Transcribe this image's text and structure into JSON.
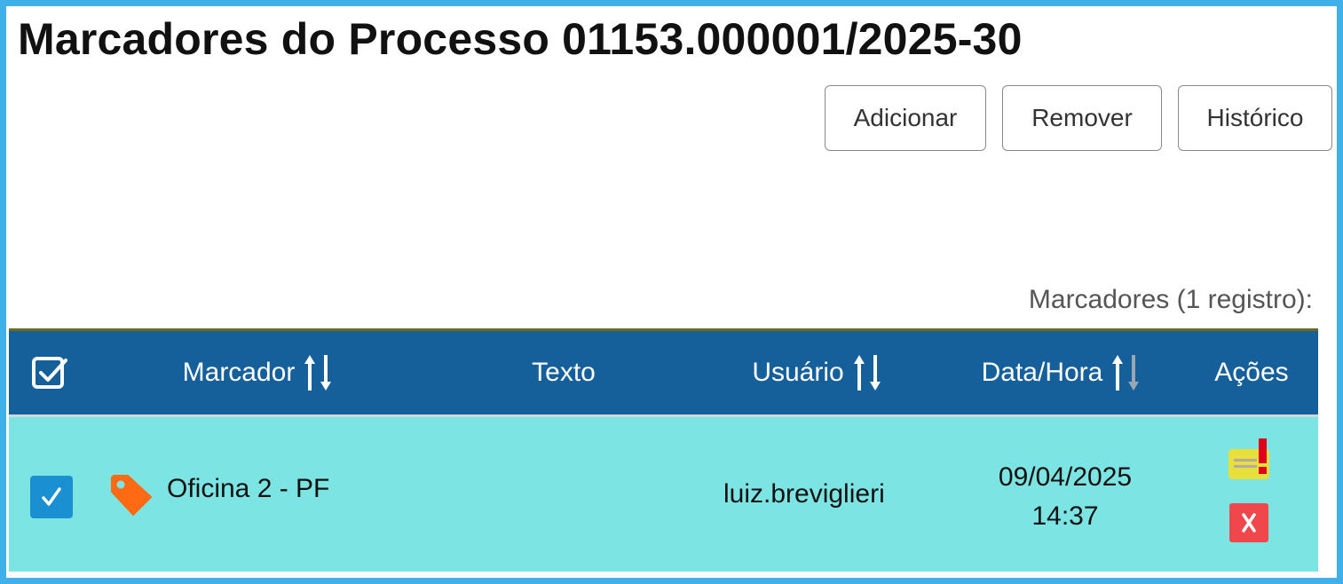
{
  "page": {
    "title": "Marcadores do Processo 01153.000001/2025-30"
  },
  "toolbar": {
    "add_label": "Adicionar",
    "remove_label": "Remover",
    "history_label": "Histórico"
  },
  "table": {
    "caption": "Marcadores (1 registro):",
    "columns": [
      "Marcador",
      "Texto",
      "Usuário",
      "Data/Hora",
      "Ações"
    ],
    "rows": [
      {
        "checked": true,
        "tag_color": "#ff6a13",
        "marker": "Oficina 2 - PF",
        "text": "",
        "user": "luiz.breviglieri",
        "date": "09/04/2025",
        "time": "14:37"
      }
    ]
  },
  "icons": {
    "select_all": "checkbox-icon",
    "sort": "sort-arrows-icon",
    "tag": "tag-icon",
    "edit_action": "edit-marker-icon",
    "remove_action": "remove-marker-icon"
  },
  "colors": {
    "frame": "#3fb0e8",
    "header_bg": "#15609a",
    "row_bg": "#7de4e4",
    "checkbox": "#1a8fd1",
    "tag": "#ff6a13",
    "edit_icon": "#e8e03a",
    "alert": "#e0001b",
    "remove_icon": "#f0474d"
  }
}
